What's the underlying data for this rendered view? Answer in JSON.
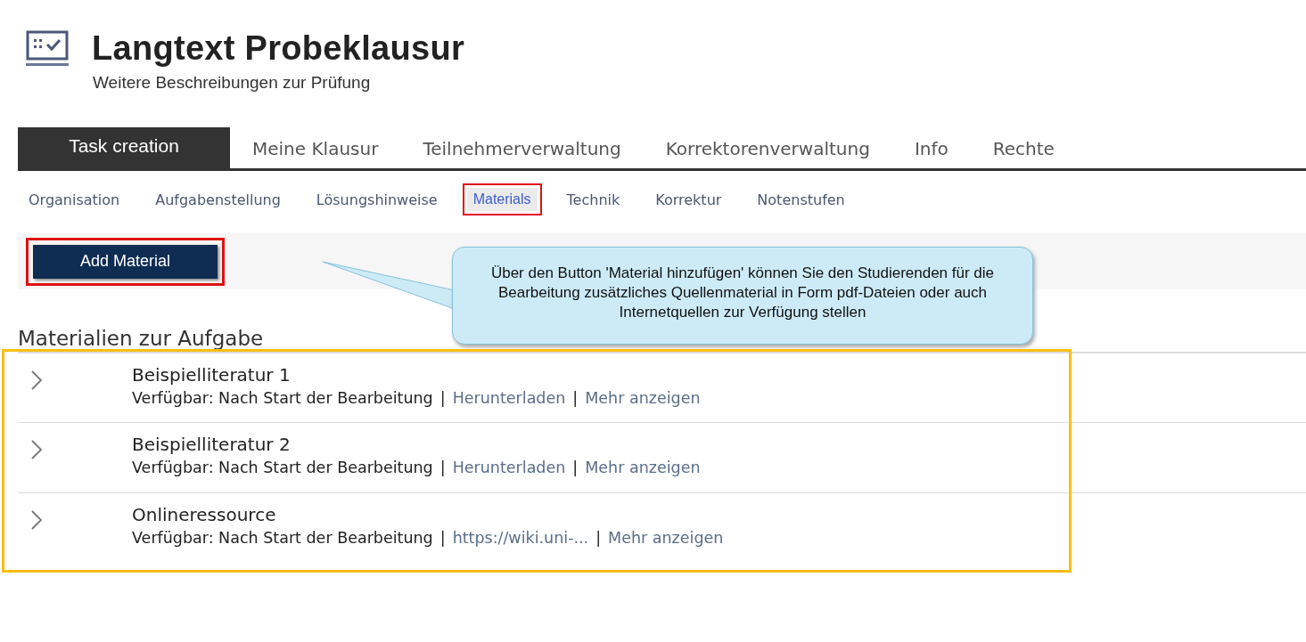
{
  "header": {
    "title": "Langtext Probeklausur",
    "subtitle": "Weitere Beschreibungen zur Prüfung"
  },
  "tabs": [
    {
      "label": "Task creation",
      "selected": true
    },
    {
      "label": "Meine Klausur",
      "selected": false
    },
    {
      "label": "Teilnehmerverwaltung",
      "selected": false
    },
    {
      "label": "Korrektorenverwaltung",
      "selected": false
    },
    {
      "label": "Info",
      "selected": false
    },
    {
      "label": "Rechte",
      "selected": false
    }
  ],
  "subtabs": [
    {
      "label": "Organisation",
      "selected": false,
      "highlighted": false
    },
    {
      "label": "Aufgabenstellung",
      "selected": false,
      "highlighted": false
    },
    {
      "label": "Lösungshinweise",
      "selected": false,
      "highlighted": false
    },
    {
      "label": "Materials",
      "selected": true,
      "highlighted": true
    },
    {
      "label": "Technik",
      "selected": false,
      "highlighted": false
    },
    {
      "label": "Korrektur",
      "selected": false,
      "highlighted": false
    },
    {
      "label": "Notenstufen",
      "selected": false,
      "highlighted": false
    }
  ],
  "add_button": {
    "label": "Add Material",
    "highlighted": true
  },
  "callout": {
    "text": "Über den Button 'Material hinzufügen' können Sie den Studierenden für die Bearbeitung zusätzliches Quellenmaterial in Form pdf-Dateien oder auch Internetquellen zur Verfügung stellen"
  },
  "materials": {
    "heading": "Materialien zur Aufgabe",
    "highlighted": true,
    "items": [
      {
        "title": "Beispielliteratur 1",
        "expanded": false,
        "parts": [
          {
            "kind": "text",
            "text": "Verfügbar: Nach Start der Bearbeitung"
          },
          {
            "kind": "sep",
            "text": "|"
          },
          {
            "kind": "link",
            "text": "Herunterladen"
          },
          {
            "kind": "sep",
            "text": "|"
          },
          {
            "kind": "link",
            "text": "Mehr anzeigen"
          }
        ]
      },
      {
        "title": "Beispielliteratur 2",
        "expanded": false,
        "parts": [
          {
            "kind": "text",
            "text": "Verfügbar: Nach Start der Bearbeitung"
          },
          {
            "kind": "sep",
            "text": "|"
          },
          {
            "kind": "link",
            "text": "Herunterladen"
          },
          {
            "kind": "sep",
            "text": "|"
          },
          {
            "kind": "link",
            "text": "Mehr anzeigen"
          }
        ]
      },
      {
        "title": "Onlineressource",
        "expanded": false,
        "parts": [
          {
            "kind": "text",
            "text": "Verfügbar: Nach Start der Bearbeitung"
          },
          {
            "kind": "sep",
            "text": "|"
          },
          {
            "kind": "link",
            "text": "https://wiki.uni-..."
          },
          {
            "kind": "sep",
            "text": "|"
          },
          {
            "kind": "link",
            "text": "Mehr anzeigen"
          }
        ]
      }
    ]
  }
}
